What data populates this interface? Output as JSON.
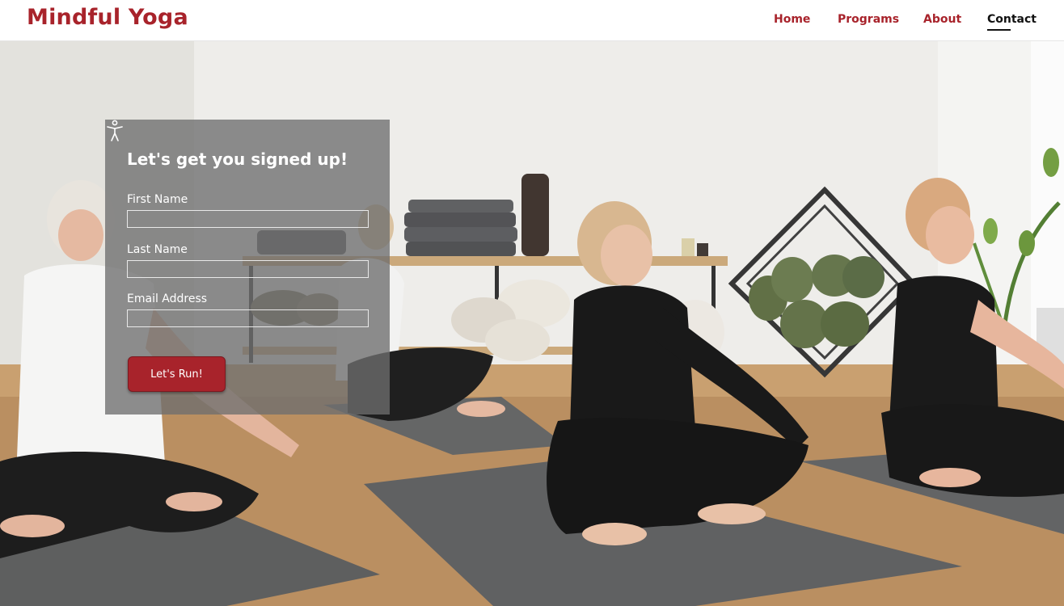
{
  "header": {
    "brand": "Mindful Yoga",
    "nav": [
      {
        "label": "Home",
        "active": false
      },
      {
        "label": "Programs",
        "active": false
      },
      {
        "label": "About",
        "active": false
      },
      {
        "label": "Contact",
        "active": true
      }
    ]
  },
  "signup_form": {
    "title": "Let's get you signed up!",
    "title_icon": "accessibility-person-icon",
    "fields": [
      {
        "label": "First Name",
        "value": ""
      },
      {
        "label": "Last Name",
        "value": ""
      },
      {
        "label": "Email Address",
        "value": ""
      }
    ],
    "submit_label": "Let's Run!"
  },
  "colors": {
    "brand": "#a8232b",
    "nav_active": "#111111",
    "panel_overlay": "#6e6e6e",
    "button": "#a8232b"
  }
}
